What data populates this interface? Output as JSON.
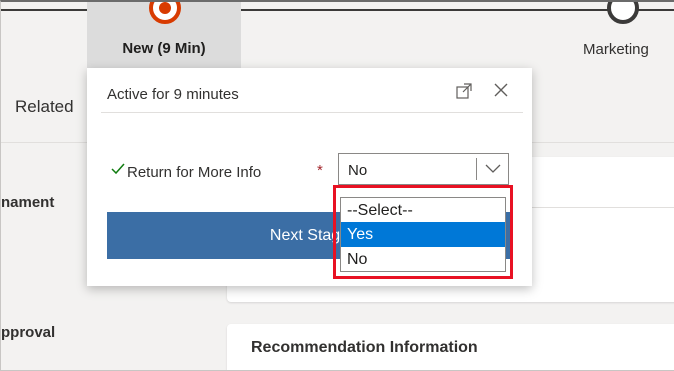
{
  "stage_bar": {
    "active_stage_label": "New  (9 Min)",
    "next_stage_label": "Marketing"
  },
  "form": {
    "related_tab": "Related",
    "label_nament": "nament",
    "label_approval": "pproval",
    "card_title": "Recommendation Information"
  },
  "flyout": {
    "title": "Active for 9 minutes",
    "expand_icon": "expand-icon",
    "close_icon": "close-icon",
    "field_label": "Return for More Info",
    "required_mark": "*",
    "select_value": "No",
    "next_stage_button": "Next Stage"
  },
  "dropdown": {
    "options": [
      "--Select--",
      "Yes",
      "No"
    ],
    "highlighted": "Yes"
  },
  "colors": {
    "active_stage": "#d83b01",
    "button_bg": "#3b6ea5",
    "selection": "#0078d7",
    "highlight_border": "#e81123",
    "check": "#107c10"
  }
}
